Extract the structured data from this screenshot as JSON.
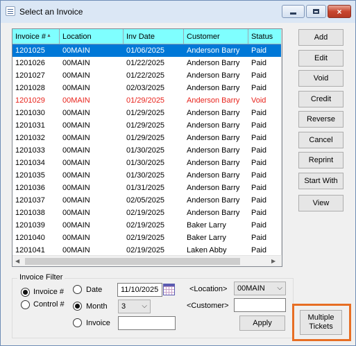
{
  "window": {
    "title": "Select an Invoice",
    "controls": {
      "minimize": "minimize",
      "maximize": "maximize",
      "close": "×"
    }
  },
  "grid": {
    "columns": [
      "Invoice #",
      "Location",
      "Inv Date",
      "Customer",
      "Status"
    ],
    "sort_indicator": "▲",
    "rows": [
      {
        "invoice": "1201025",
        "location": "00MAIN",
        "date": "01/06/2025",
        "customer": "Anderson Barry",
        "status": "Paid"
      },
      {
        "invoice": "1201026",
        "location": "00MAIN",
        "date": "01/22/2025",
        "customer": "Anderson Barry",
        "status": "Paid"
      },
      {
        "invoice": "1201027",
        "location": "00MAIN",
        "date": "01/22/2025",
        "customer": "Anderson Barry",
        "status": "Paid"
      },
      {
        "invoice": "1201028",
        "location": "00MAIN",
        "date": "02/03/2025",
        "customer": "Anderson Barry",
        "status": "Paid"
      },
      {
        "invoice": "1201029",
        "location": "00MAIN",
        "date": "01/29/2025",
        "customer": "Anderson Barry",
        "status": "Void"
      },
      {
        "invoice": "1201030",
        "location": "00MAIN",
        "date": "01/29/2025",
        "customer": "Anderson Barry",
        "status": "Paid"
      },
      {
        "invoice": "1201031",
        "location": "00MAIN",
        "date": "01/29/2025",
        "customer": "Anderson Barry",
        "status": "Paid"
      },
      {
        "invoice": "1201032",
        "location": "00MAIN",
        "date": "01/29/2025",
        "customer": "Anderson Barry",
        "status": "Paid"
      },
      {
        "invoice": "1201033",
        "location": "00MAIN",
        "date": "01/30/2025",
        "customer": "Anderson Barry",
        "status": "Paid"
      },
      {
        "invoice": "1201034",
        "location": "00MAIN",
        "date": "01/30/2025",
        "customer": "Anderson Barry",
        "status": "Paid"
      },
      {
        "invoice": "1201035",
        "location": "00MAIN",
        "date": "01/30/2025",
        "customer": "Anderson Barry",
        "status": "Paid"
      },
      {
        "invoice": "1201036",
        "location": "00MAIN",
        "date": "01/31/2025",
        "customer": "Anderson Barry",
        "status": "Paid"
      },
      {
        "invoice": "1201037",
        "location": "00MAIN",
        "date": "02/05/2025",
        "customer": "Anderson Barry",
        "status": "Paid"
      },
      {
        "invoice": "1201038",
        "location": "00MAIN",
        "date": "02/19/2025",
        "customer": "Anderson Barry",
        "status": "Paid"
      },
      {
        "invoice": "1201039",
        "location": "00MAIN",
        "date": "02/19/2025",
        "customer": "Baker Larry",
        "status": "Paid"
      },
      {
        "invoice": "1201040",
        "location": "00MAIN",
        "date": "02/19/2025",
        "customer": "Baker Larry",
        "status": "Paid"
      },
      {
        "invoice": "1201041",
        "location": "00MAIN",
        "date": "02/19/2025",
        "customer": "Laken Abby",
        "status": "Paid"
      }
    ],
    "selected_row": 0,
    "void_status": "Void",
    "colors": {
      "header_bg": "#7fffff",
      "selected_bg": "#0078d7",
      "void_text": "#e8221b"
    }
  },
  "buttons": [
    "Add",
    "Edit",
    "Void",
    "Credit",
    "Reverse",
    "Cancel",
    "Reprint",
    "Start With",
    "View"
  ],
  "filter": {
    "legend": "Invoice Filter",
    "sort_by": [
      {
        "label": "Invoice #",
        "checked": true
      },
      {
        "label": "Control #",
        "checked": false
      }
    ],
    "date_label": "Date",
    "date_value": "11/10/2025",
    "month_label": "Month",
    "month_value": "3",
    "invoice_label": "Invoice",
    "invoice_value": "",
    "mode_selected": "Month",
    "location_label": "<Location>",
    "location_value": "00MAIN",
    "customer_label": "<Customer>",
    "customer_value": "",
    "apply_label": "Apply"
  },
  "multiple_tickets": {
    "line1": "Multiple",
    "line2": "Tickets",
    "highlight_color": "#e76e24"
  }
}
